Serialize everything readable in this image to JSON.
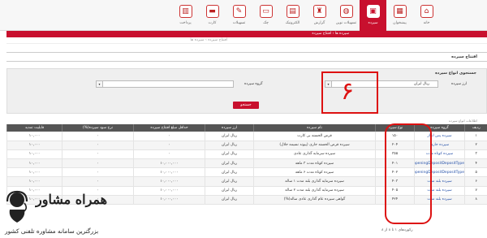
{
  "nav": {
    "items": [
      {
        "label": "خانه",
        "icon": "home-icon",
        "glyph": "⌂"
      },
      {
        "label": "پیشخوان",
        "icon": "dashboard-icon",
        "glyph": "▦"
      },
      {
        "label": "سپرده",
        "icon": "deposit-icon",
        "glyph": "▣",
        "active": true
      },
      {
        "label": "تسهیلات نوین",
        "icon": "loan-icon",
        "glyph": "◍"
      },
      {
        "label": "گزارش",
        "icon": "report-icon",
        "glyph": "♜"
      },
      {
        "label": "الکترونیک",
        "icon": "electronic-icon",
        "glyph": "▤"
      },
      {
        "label": "چک",
        "icon": "cheque-icon",
        "glyph": "▭"
      },
      {
        "label": "تسهیلات",
        "icon": "facility-icon",
        "glyph": "✎"
      },
      {
        "label": "کارت",
        "icon": "card-icon",
        "glyph": "▬"
      },
      {
        "label": "پرداخت",
        "icon": "payment-icon",
        "glyph": "▥"
      }
    ]
  },
  "breadcrumb": {
    "main": "سپرده ها  ›  افتتاح سپرده",
    "sub": "افتتاح سپرده  ›  سپرده ها"
  },
  "page": {
    "title": "افتتاح سپرده"
  },
  "filter": {
    "title": "جستجوی انواع سپرده",
    "currency_label": "ارز سپرده",
    "currency_value": "ریال ایران",
    "group_label": "گروه سپرده",
    "group_value": "",
    "search_button": "جستجو"
  },
  "annotation": {
    "number": "۶"
  },
  "table": {
    "caption": "اطلاعات انواع سپرده",
    "headers": [
      "ردیف",
      "گروه سپرده",
      "نوع سپرده",
      "نام سپرده",
      "ارز سپرده",
      "حداقل مبلغ افتتاح سپرده",
      "نرخ سود سپرده(%)",
      "قابلیت تمدید"
    ],
    "rows": [
      [
        "۱",
        "سپرده پس انداز",
        "۱۵۰",
        "قرض الحسنه بی کارت",
        "ریال ایران",
        "۰",
        "۰",
        "۱۰,۰۰۰"
      ],
      [
        "۲",
        "سپرده جاری",
        "۲۰۴",
        "سپرده قرض الحسنه جاری (پیوند نسیمه جلال)",
        "ریال ایران",
        "۰",
        "۰",
        "۱۰,۰۰۰"
      ],
      [
        "۳",
        "سپرده کوتاه مدت",
        "۳۵۵",
        "سپرده سرمایه گذاری عادی",
        "ریال ایران",
        "۰",
        "۰",
        "۱۰,۰۰۰"
      ],
      [
        "۴",
        "openingDepositDepositType",
        "۴۰۱",
        "سپرده کوتاه مدت ۳ ماهه",
        "ریال ایران",
        "۱۰,۰۰۰,۰۰۰",
        "۰",
        "۱۰,۰۰۰"
      ],
      [
        "۵",
        "openingDepositDepositType",
        "۴۰۲",
        "سپرده کوتاه مدت ۶ ماهه",
        "ریال ایران",
        "۱۰,۰۰۰,۰۰۰",
        "۰",
        "۱۰,۰۰۰"
      ],
      [
        "۶",
        "سپرده بلند مدت",
        "۴۰۳",
        "سپرده سرمایه گذاری بلند مدت ۱ ساله",
        "ریال ایران",
        "۱۰,۰۰۰,۰۰۰",
        "۰",
        "۱۰,۰۰۰"
      ],
      [
        "۷",
        "سپرده بلند مدت",
        "۴۰۵",
        "سپرده سرمایه گذاری بلند مدت ۲ ساله",
        "ریال ایران",
        "۱۰,۰۰۰,۰۰۰",
        "۰",
        "۱۰,۰۰۰"
      ],
      [
        "۸",
        "سپرده بلند مدت",
        "۴۲۴",
        "گواهی سپرده عام گذاری عادی ساله(%)",
        "ریال ایران",
        "۱۰,۰۰۰,۰۰۰",
        "۰",
        "۱۰,۰۰۰"
      ]
    ]
  },
  "pager": "رکوردهای ۱ تا ۸ از ۸",
  "logo": {
    "title": "همراه مشاور",
    "subtitle": "بزرگترین سامانه مشاوره تلفنی کشور"
  }
}
